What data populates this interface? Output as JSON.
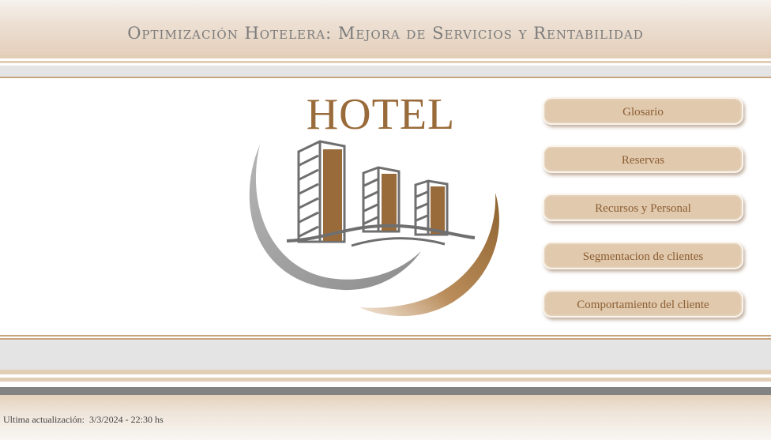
{
  "header": {
    "title": "Optimización Hotelera: Mejora de Servicios y Rentabilidad"
  },
  "logo": {
    "text": "HOTEL",
    "icon": "hotel-buildings-logo"
  },
  "nav": {
    "items": [
      {
        "label": "Glosario"
      },
      {
        "label": "Reservas"
      },
      {
        "label": "Recursos y Personal"
      },
      {
        "label": "Segmentacion de clientes"
      },
      {
        "label": "Comportamiento del cliente"
      }
    ]
  },
  "footer": {
    "last_update_label": "Ultima actualización:",
    "last_update_value": "3/3/2024 - 22:30 hs"
  },
  "colors": {
    "accent_brown": "#9a6b3a",
    "button_bg": "#e0c9ad",
    "header_beige": "#e4cfbb",
    "gray_band": "#838383"
  }
}
